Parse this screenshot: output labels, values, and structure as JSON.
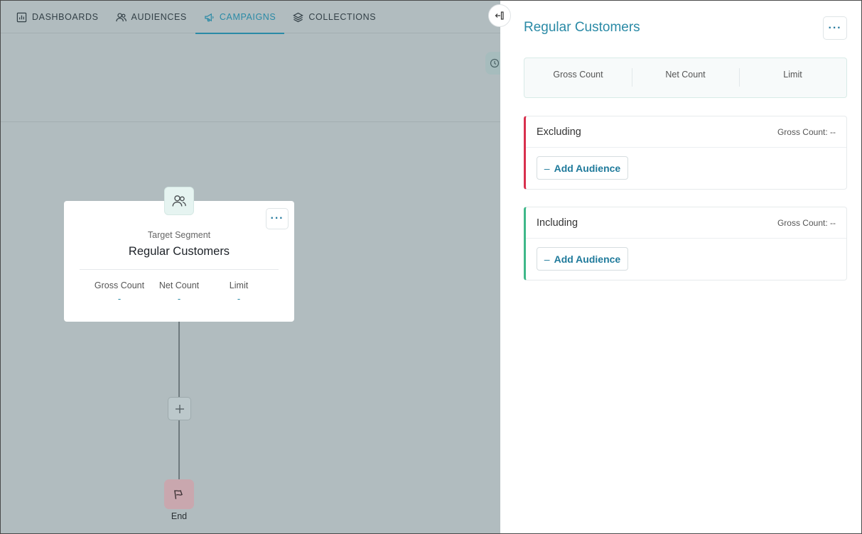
{
  "nav": {
    "items": [
      {
        "label": "DASHBOARDS",
        "icon": "bar-chart-icon"
      },
      {
        "label": "AUDIENCES",
        "icon": "users-icon"
      },
      {
        "label": "CAMPAIGNS",
        "icon": "megaphone-icon",
        "active": true
      },
      {
        "label": "COLLECTIONS",
        "icon": "layers-icon"
      }
    ]
  },
  "canvas": {
    "segment_card": {
      "subtitle": "Target Segment",
      "title": "Regular Customers",
      "menu_label": "···",
      "stats": [
        {
          "label": "Gross Count",
          "value": "-"
        },
        {
          "label": "Net Count",
          "value": "-"
        },
        {
          "label": "Limit",
          "value": "-"
        }
      ]
    },
    "end_label": "End"
  },
  "panel": {
    "title": "Regular Customers",
    "menu_label": "···",
    "stats": [
      {
        "label": "Gross Count"
      },
      {
        "label": "Net Count"
      },
      {
        "label": "Limit"
      }
    ],
    "excluding": {
      "name": "Excluding",
      "gross_count": "Gross Count: --",
      "add_label": "Add Audience"
    },
    "including": {
      "name": "Including",
      "gross_count": "Gross Count: --",
      "add_label": "Add Audience"
    }
  },
  "colors": {
    "accent": "#2a8aa6",
    "exclude": "#d8304d",
    "include": "#3fb889",
    "overlay": "#b1bcbf"
  }
}
